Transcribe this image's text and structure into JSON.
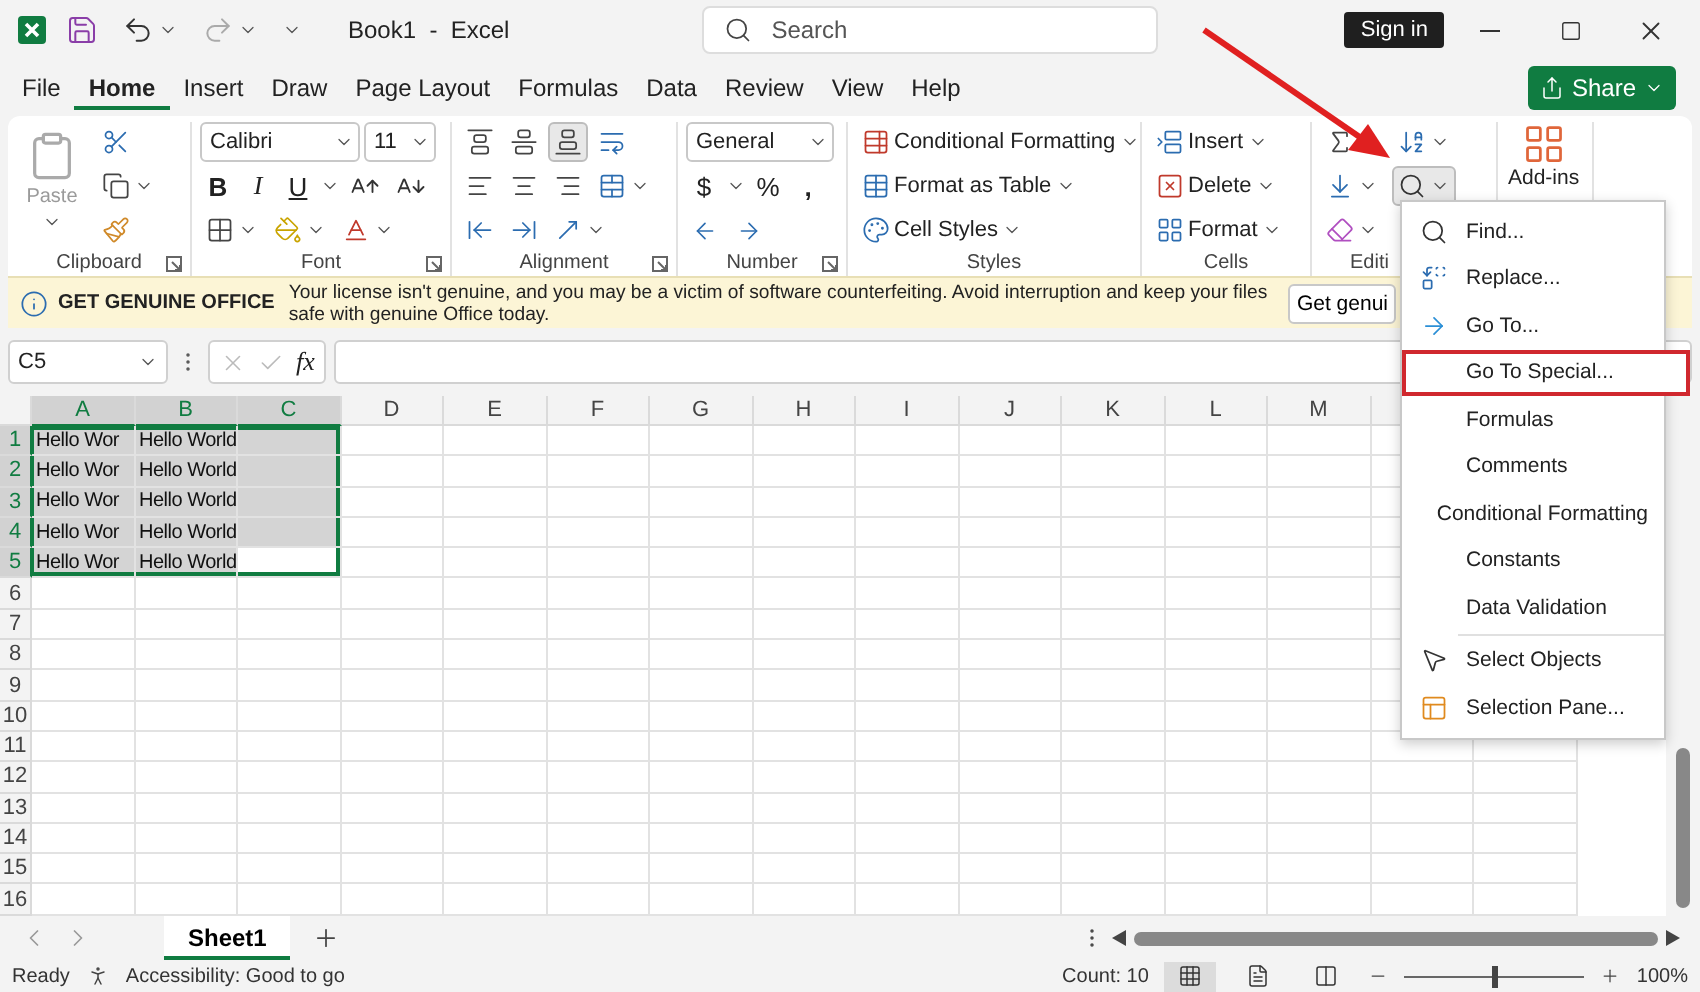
{
  "title_bar": {
    "title": "Book1  -  Excel",
    "search": {
      "placeholder": "Search"
    },
    "sign_in": "Sign in"
  },
  "menu_tabs": [
    {
      "label": "File",
      "selected": false
    },
    {
      "label": "Home",
      "selected": true
    },
    {
      "label": "Insert",
      "selected": false
    },
    {
      "label": "Draw",
      "selected": false
    },
    {
      "label": "Page Layout",
      "selected": false
    },
    {
      "label": "Formulas",
      "selected": false
    },
    {
      "label": "Data",
      "selected": false
    },
    {
      "label": "Review",
      "selected": false
    },
    {
      "label": "View",
      "selected": false
    },
    {
      "label": "Help",
      "selected": false
    }
  ],
  "share": "Share",
  "ribbon": {
    "clipboard": {
      "label": "Clipboard",
      "paste": "Paste",
      "paste_disabled": true
    },
    "font": {
      "label": "Font",
      "font_name": "Calibri",
      "font_size": "11",
      "bold": "B",
      "italic": "I",
      "underline": "U"
    },
    "alignment": {
      "label": "Alignment",
      "vertical": [
        {
          "kind": "top",
          "selected": false
        },
        {
          "kind": "middle",
          "selected": false
        },
        {
          "kind": "bottom",
          "selected": true
        }
      ]
    },
    "number": {
      "label": "Number",
      "format": "General",
      "currency": "$",
      "percent": "%",
      "comma": ","
    },
    "styles": {
      "label": "Styles",
      "buttons": [
        "Conditional Formatting",
        "Format as Table",
        "Cell Styles"
      ]
    },
    "cells": {
      "label": "Cells",
      "buttons": [
        "Insert",
        "Delete",
        "Format"
      ]
    },
    "editing": {
      "label": "Editi",
      "find_expanded": true
    },
    "addins": {
      "label": "Add-ins"
    }
  },
  "banner": {
    "title": "GET GENUINE OFFICE",
    "message": "Your license isn't genuine, and you may be a victim of software counterfeiting. Avoid interruption and keep your files safe with genuine Office today.",
    "button": "Get genui"
  },
  "formula_bar": {
    "name_box": "C5",
    "fx": "fx"
  },
  "grid": {
    "columns": [
      {
        "label": "A",
        "selected": true
      },
      {
        "label": "B",
        "selected": true
      },
      {
        "label": "C",
        "selected": true
      },
      {
        "label": "D",
        "selected": false
      },
      {
        "label": "E",
        "selected": false
      },
      {
        "label": "F",
        "selected": false
      },
      {
        "label": "G",
        "selected": false
      },
      {
        "label": "H",
        "selected": false
      },
      {
        "label": "I",
        "selected": false
      },
      {
        "label": "J",
        "selected": false
      },
      {
        "label": "K",
        "selected": false
      },
      {
        "label": "L",
        "selected": false
      },
      {
        "label": "M",
        "selected": false
      }
    ],
    "rows": [
      {
        "number": "1",
        "selected": true,
        "cells": [
          {
            "text": "Hello Wor",
            "selected": true,
            "active": false
          },
          {
            "text": "Hello World",
            "selected": true,
            "active": false
          },
          {
            "selected": true,
            "active": false
          }
        ]
      },
      {
        "number": "2",
        "selected": true,
        "cells": [
          {
            "text": "Hello Wor",
            "selected": true,
            "active": false
          },
          {
            "text": "Hello World",
            "selected": true,
            "active": false
          },
          {
            "selected": true,
            "active": false
          }
        ]
      },
      {
        "number": "3",
        "selected": true,
        "cells": [
          {
            "text": "Hello Wor",
            "selected": true,
            "active": false
          },
          {
            "text": "Hello World",
            "selected": true,
            "active": false
          },
          {
            "selected": true,
            "active": false
          }
        ]
      },
      {
        "number": "4",
        "selected": true,
        "cells": [
          {
            "text": "Hello Wor",
            "selected": true,
            "active": false
          },
          {
            "text": "Hello World",
            "selected": true,
            "active": false
          },
          {
            "selected": true,
            "active": false
          }
        ]
      },
      {
        "number": "5",
        "selected": true,
        "cells": [
          {
            "text": "Hello Wor",
            "selected": true,
            "active": false
          },
          {
            "text": "Hello World",
            "selected": true,
            "active": false
          },
          {
            "selected": true,
            "active": true
          }
        ]
      },
      {
        "number": "6",
        "selected": false,
        "cells": []
      },
      {
        "number": "7",
        "selected": false,
        "cells": []
      },
      {
        "number": "8",
        "selected": false,
        "cells": []
      },
      {
        "number": "9",
        "selected": false,
        "cells": []
      },
      {
        "number": "10",
        "selected": false,
        "cells": []
      },
      {
        "number": "11",
        "selected": false,
        "cells": []
      },
      {
        "number": "12",
        "selected": false,
        "cells": []
      },
      {
        "number": "13",
        "selected": false,
        "cells": []
      },
      {
        "number": "14",
        "selected": false,
        "cells": []
      },
      {
        "number": "15",
        "selected": false,
        "cells": []
      },
      {
        "number": "16",
        "selected": false,
        "cells": []
      }
    ]
  },
  "find_menu": {
    "items": [
      {
        "label": "Find...",
        "kind": "find",
        "highlighted": false
      },
      {
        "label": "Replace...",
        "kind": "replace",
        "highlighted": false
      },
      {
        "label": "Go To...",
        "kind": "goto",
        "highlighted": false
      },
      {
        "label": "Go To Special...",
        "kind": "plain",
        "highlighted": true
      },
      {
        "label": "Formulas",
        "kind": "plain",
        "highlighted": false
      },
      {
        "label": "Comments",
        "kind": "plain",
        "highlighted": false
      },
      {
        "label": "Conditional Formatting",
        "kind": "plain",
        "highlighted": false
      },
      {
        "label": "Constants",
        "kind": "plain",
        "highlighted": false
      },
      {
        "label": "Data Validation",
        "kind": "plain",
        "highlighted": false
      },
      {
        "label": "Select Objects",
        "kind": "select",
        "highlighted": false
      },
      {
        "label": "Selection Pane...",
        "kind": "pane",
        "highlighted": false
      }
    ]
  },
  "sheet_tabs": [
    {
      "label": "Sheet1",
      "selected": true
    }
  ],
  "status_bar": {
    "ready": "Ready",
    "accessibility": "Accessibility: Good to go",
    "count": "Count: 10",
    "views": [
      {
        "kind": "normal",
        "selected": true
      },
      {
        "kind": "page_layout",
        "selected": false
      },
      {
        "kind": "page_break",
        "selected": false
      }
    ],
    "zoom": {
      "level": 0.5,
      "reading": "100%"
    }
  }
}
